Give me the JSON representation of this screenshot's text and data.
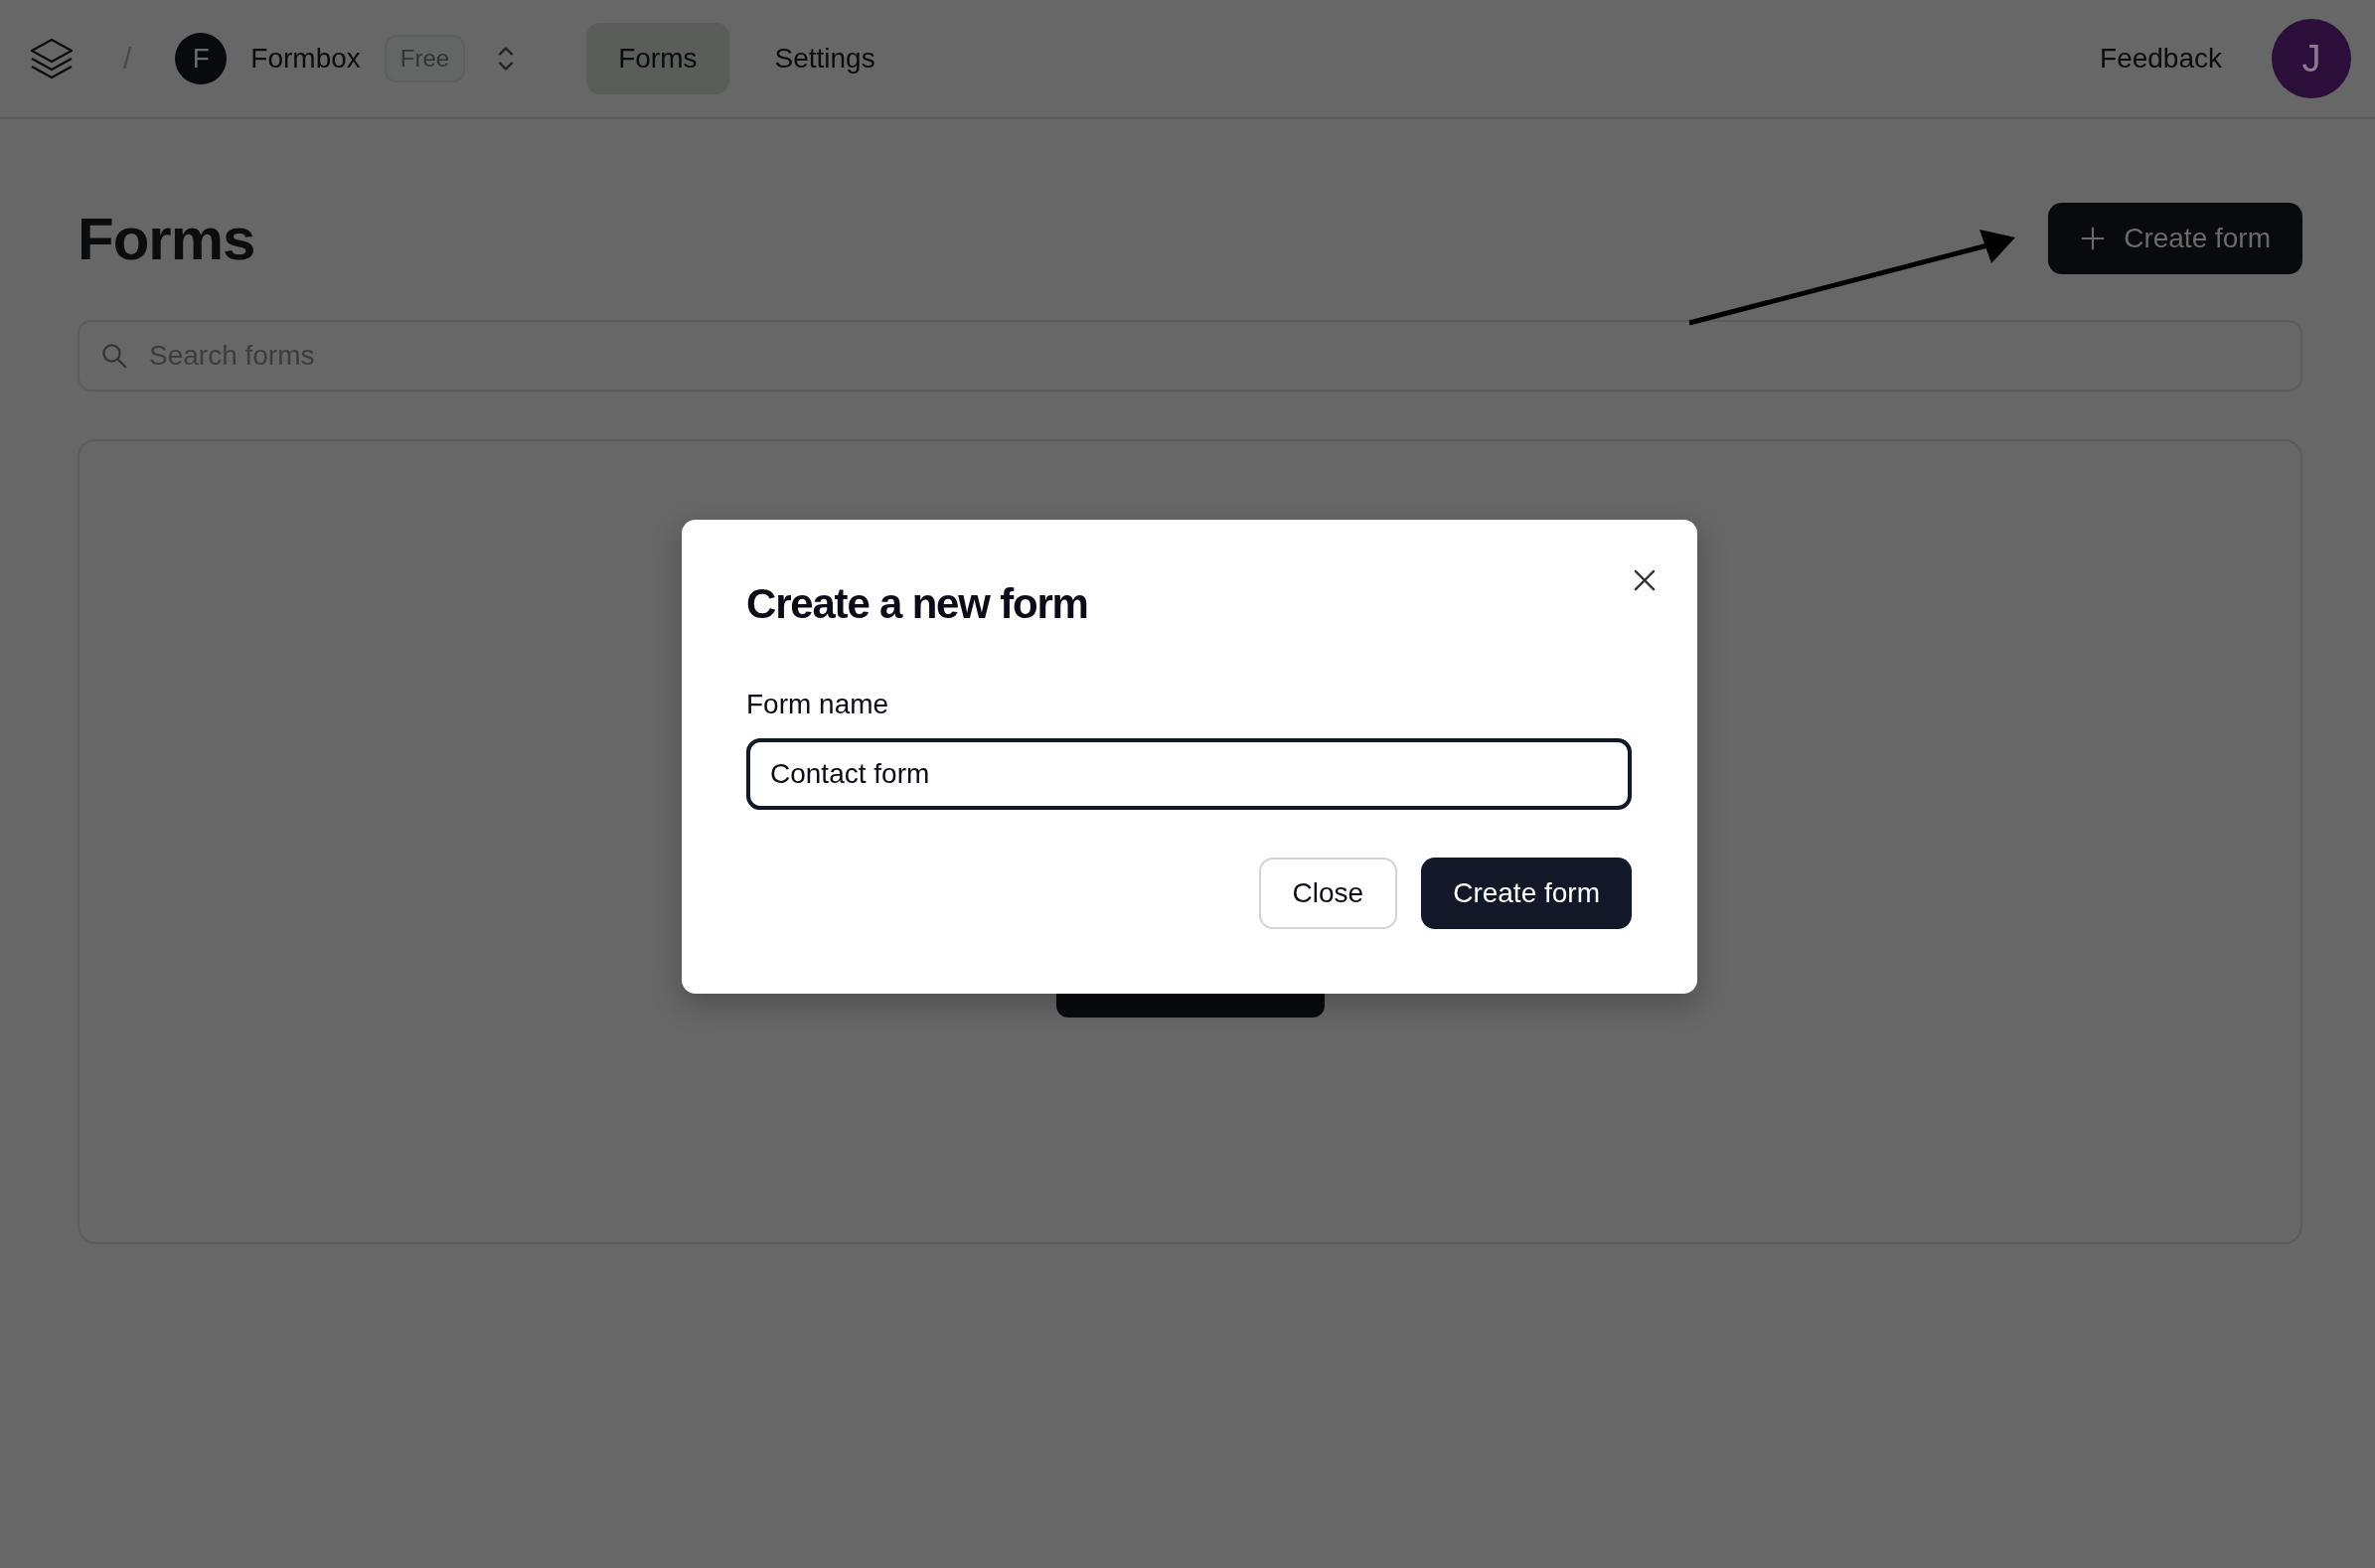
{
  "header": {
    "separator": "/",
    "workspace": {
      "initial": "F",
      "name": "Formbox",
      "plan": "Free"
    },
    "tabs": [
      {
        "label": "Forms",
        "selected": true
      },
      {
        "label": "Settings",
        "selected": false
      }
    ],
    "feedback": "Feedback",
    "avatar": "J"
  },
  "page": {
    "title": "Forms",
    "create_button": "Create form",
    "search": {
      "placeholder": "Search forms"
    }
  },
  "dialog": {
    "title": "Create a new form",
    "field_label": "Form name",
    "field_value": "Contact form",
    "buttons": [
      {
        "label": "Close",
        "kind": "secondary"
      },
      {
        "label": "Create form",
        "kind": "primary"
      }
    ]
  }
}
